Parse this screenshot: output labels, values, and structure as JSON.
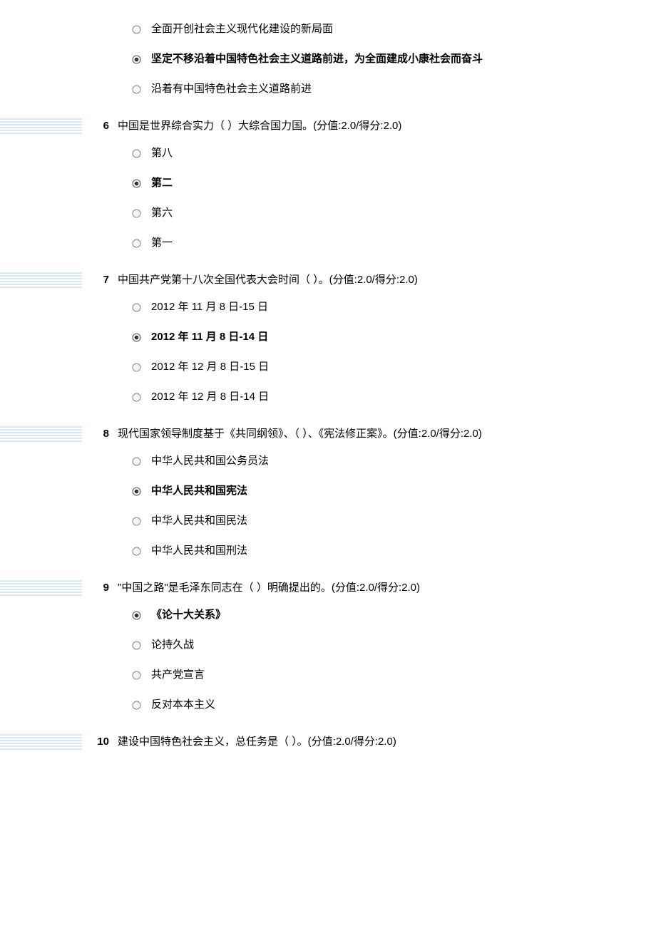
{
  "questions": [
    {
      "num": "",
      "text": "",
      "options": [
        {
          "label": "全面开创社会主义现代化建设的新局面",
          "selected": false,
          "bold": false
        },
        {
          "label": "坚定不移沿着中国特色社会主义道路前进，为全面建成小康社会而奋斗",
          "selected": true,
          "bold": true
        },
        {
          "label": "沿着有中国特色社会主义道路前进",
          "selected": false,
          "bold": false
        }
      ]
    },
    {
      "num": "6",
      "text": "中国是世界综合实力（ ）大综合国力国。(分值:2.0/得分:2.0)",
      "options": [
        {
          "label": "第八",
          "selected": false,
          "bold": false
        },
        {
          "label": "第二",
          "selected": true,
          "bold": true
        },
        {
          "label": "第六",
          "selected": false,
          "bold": false
        },
        {
          "label": "第一",
          "selected": false,
          "bold": false
        }
      ]
    },
    {
      "num": "7",
      "text": "中国共产党第十八次全国代表大会时间（ ）。(分值:2.0/得分:2.0)",
      "options": [
        {
          "label": "2012 年 11 月 8 日-15 日",
          "selected": false,
          "bold": false
        },
        {
          "label": "2012 年 11 月 8 日-14 日",
          "selected": true,
          "bold": true
        },
        {
          "label": "2012 年 12 月 8 日-15 日",
          "selected": false,
          "bold": false
        },
        {
          "label": "2012 年 12 月 8 日-14 日",
          "selected": false,
          "bold": false
        }
      ]
    },
    {
      "num": "8",
      "text": "现代国家领导制度基于《共同纲领》、（ ）、《宪法修正案》。(分值:2.0/得分:2.0)",
      "options": [
        {
          "label": "中华人民共和国公务员法",
          "selected": false,
          "bold": false
        },
        {
          "label": "中华人民共和国宪法",
          "selected": true,
          "bold": true
        },
        {
          "label": "中华人民共和国民法",
          "selected": false,
          "bold": false
        },
        {
          "label": "中华人民共和国刑法",
          "selected": false,
          "bold": false
        }
      ]
    },
    {
      "num": "9",
      "text": "\"中国之路\"是毛泽东同志在（ ）明确提出的。(分值:2.0/得分:2.0)",
      "options": [
        {
          "label": "《论十大关系》",
          "selected": true,
          "bold": true
        },
        {
          "label": "论持久战",
          "selected": false,
          "bold": false
        },
        {
          "label": "共产党宣言",
          "selected": false,
          "bold": false
        },
        {
          "label": "反对本本主义",
          "selected": false,
          "bold": false
        }
      ]
    },
    {
      "num": "10",
      "text": "建设中国特色社会主义，总任务是（ ）。(分值:2.0/得分:2.0)",
      "options": []
    }
  ]
}
